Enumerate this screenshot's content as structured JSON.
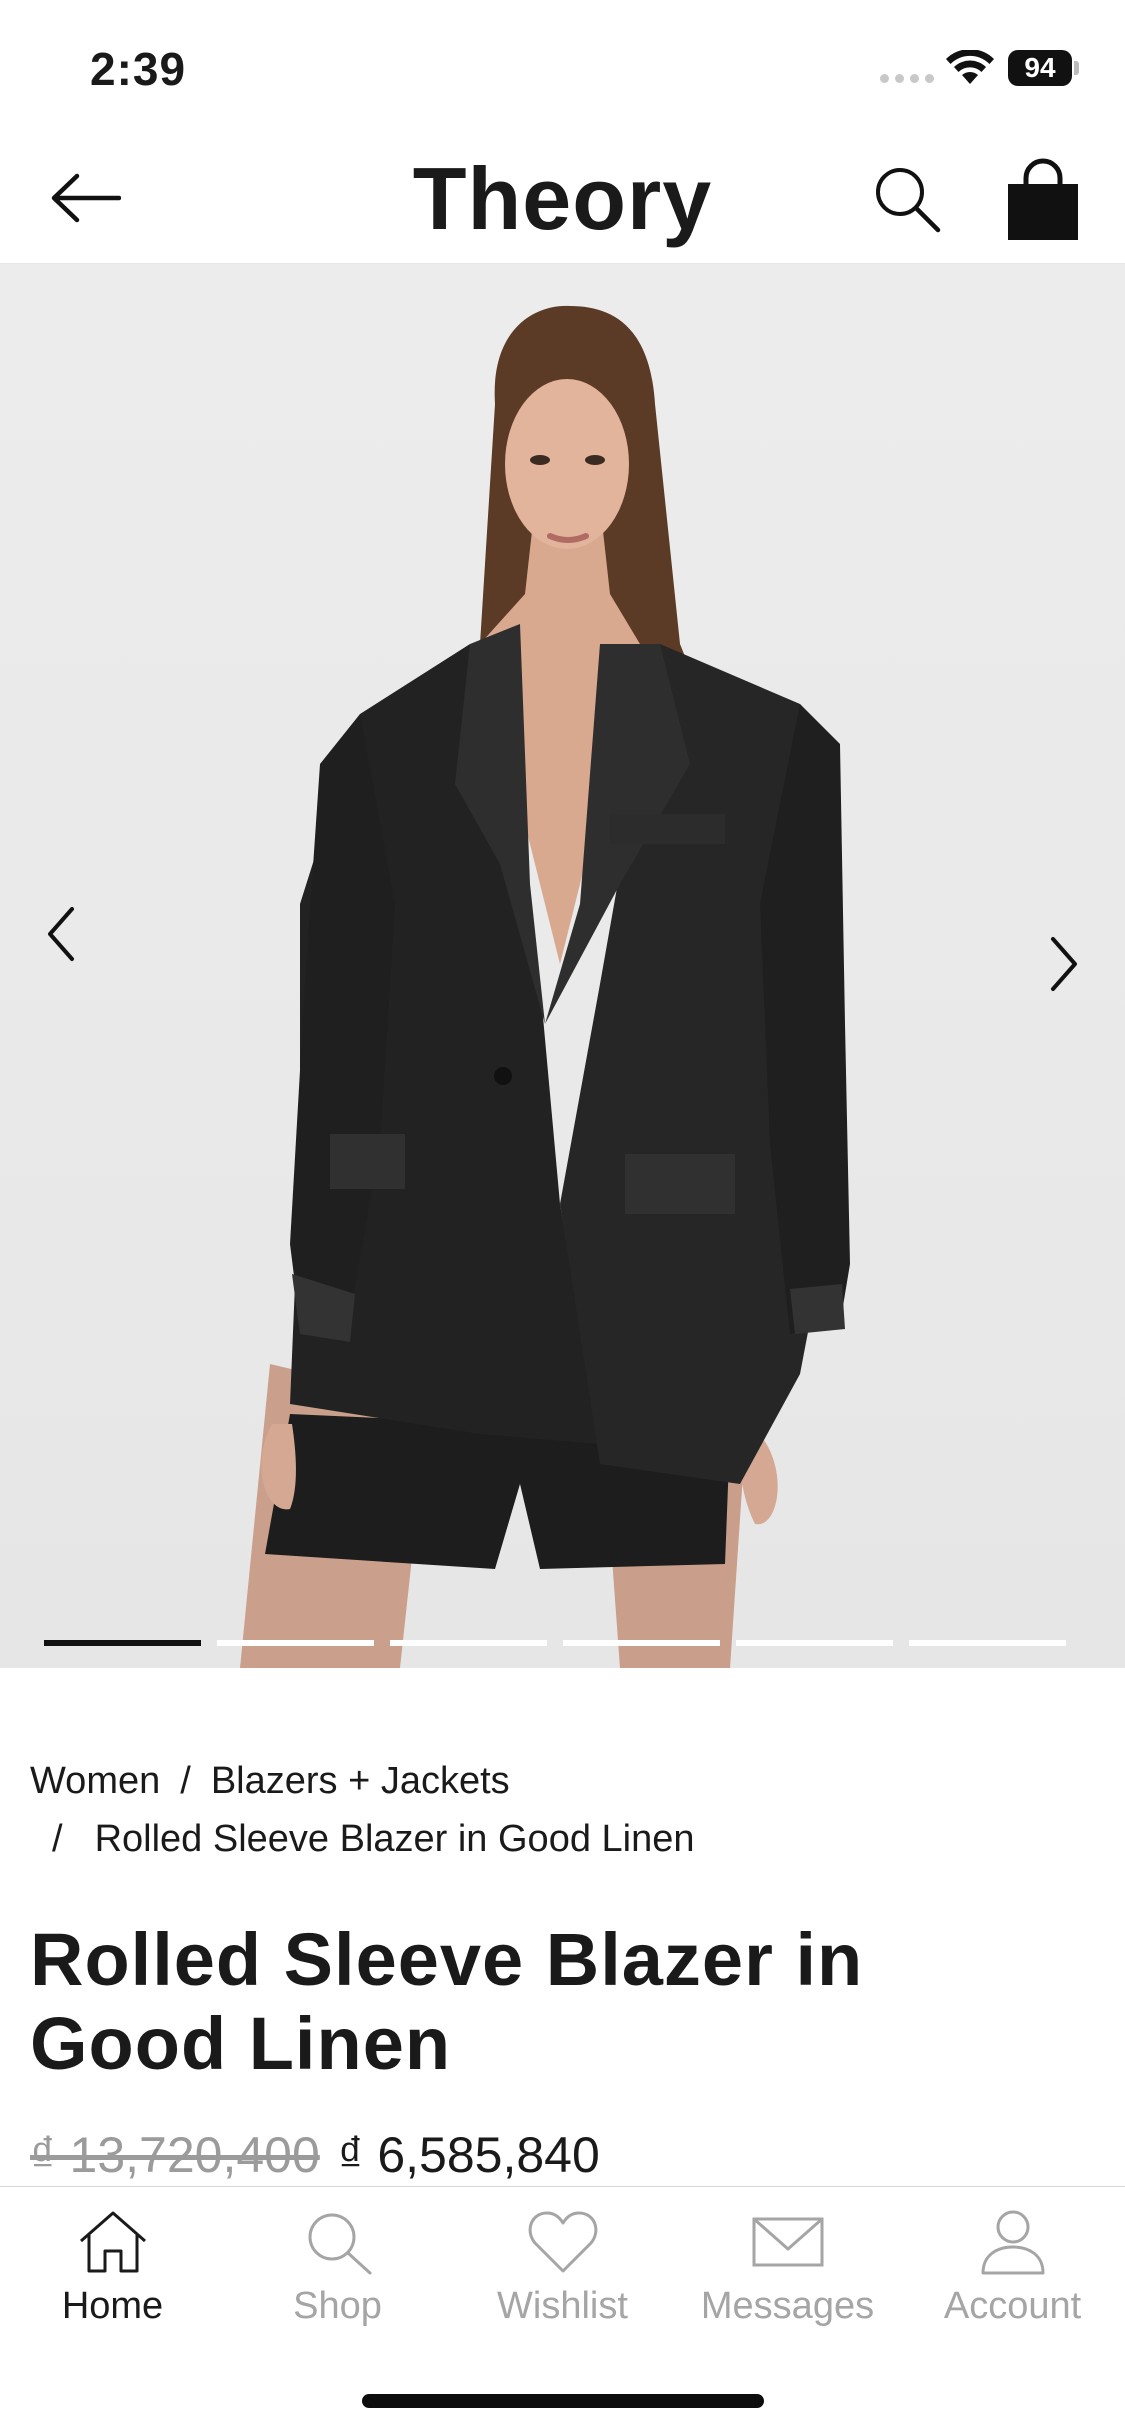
{
  "status_bar": {
    "time": "2:39",
    "battery": "94"
  },
  "header": {
    "brand": "Theory",
    "back_icon": "arrow-left-icon",
    "search_icon": "search-icon",
    "bag_icon": "shopping-bag-icon"
  },
  "gallery": {
    "image": "model wearing black rolled sleeve blazer and black shorts",
    "prev_icon": "chevron-left-icon",
    "next_icon": "chevron-right-icon",
    "total_images": 6,
    "active_index": 0
  },
  "breadcrumb": {
    "items": [
      "Women",
      "Blazers + Jackets",
      "Rolled Sleeve Blazer in Good Linen"
    ],
    "separator": "/"
  },
  "product": {
    "title": "Rolled Sleeve Blazer in Good Linen",
    "price_original": "₫ 13,720,400",
    "price_sale": "₫ 6,585,840"
  },
  "tabbar": {
    "tabs": [
      {
        "label": "Home",
        "icon": "home-icon",
        "active": true
      },
      {
        "label": "Shop",
        "icon": "search-icon",
        "active": false
      },
      {
        "label": "Wishlist",
        "icon": "heart-icon",
        "active": false
      },
      {
        "label": "Messages",
        "icon": "envelope-icon",
        "active": false
      },
      {
        "label": "Account",
        "icon": "person-icon",
        "active": false
      }
    ]
  },
  "colors": {
    "text": "#1a1a1a",
    "muted": "#9b9b9b",
    "background": "#ffffff",
    "image_bg": "#ececec"
  }
}
